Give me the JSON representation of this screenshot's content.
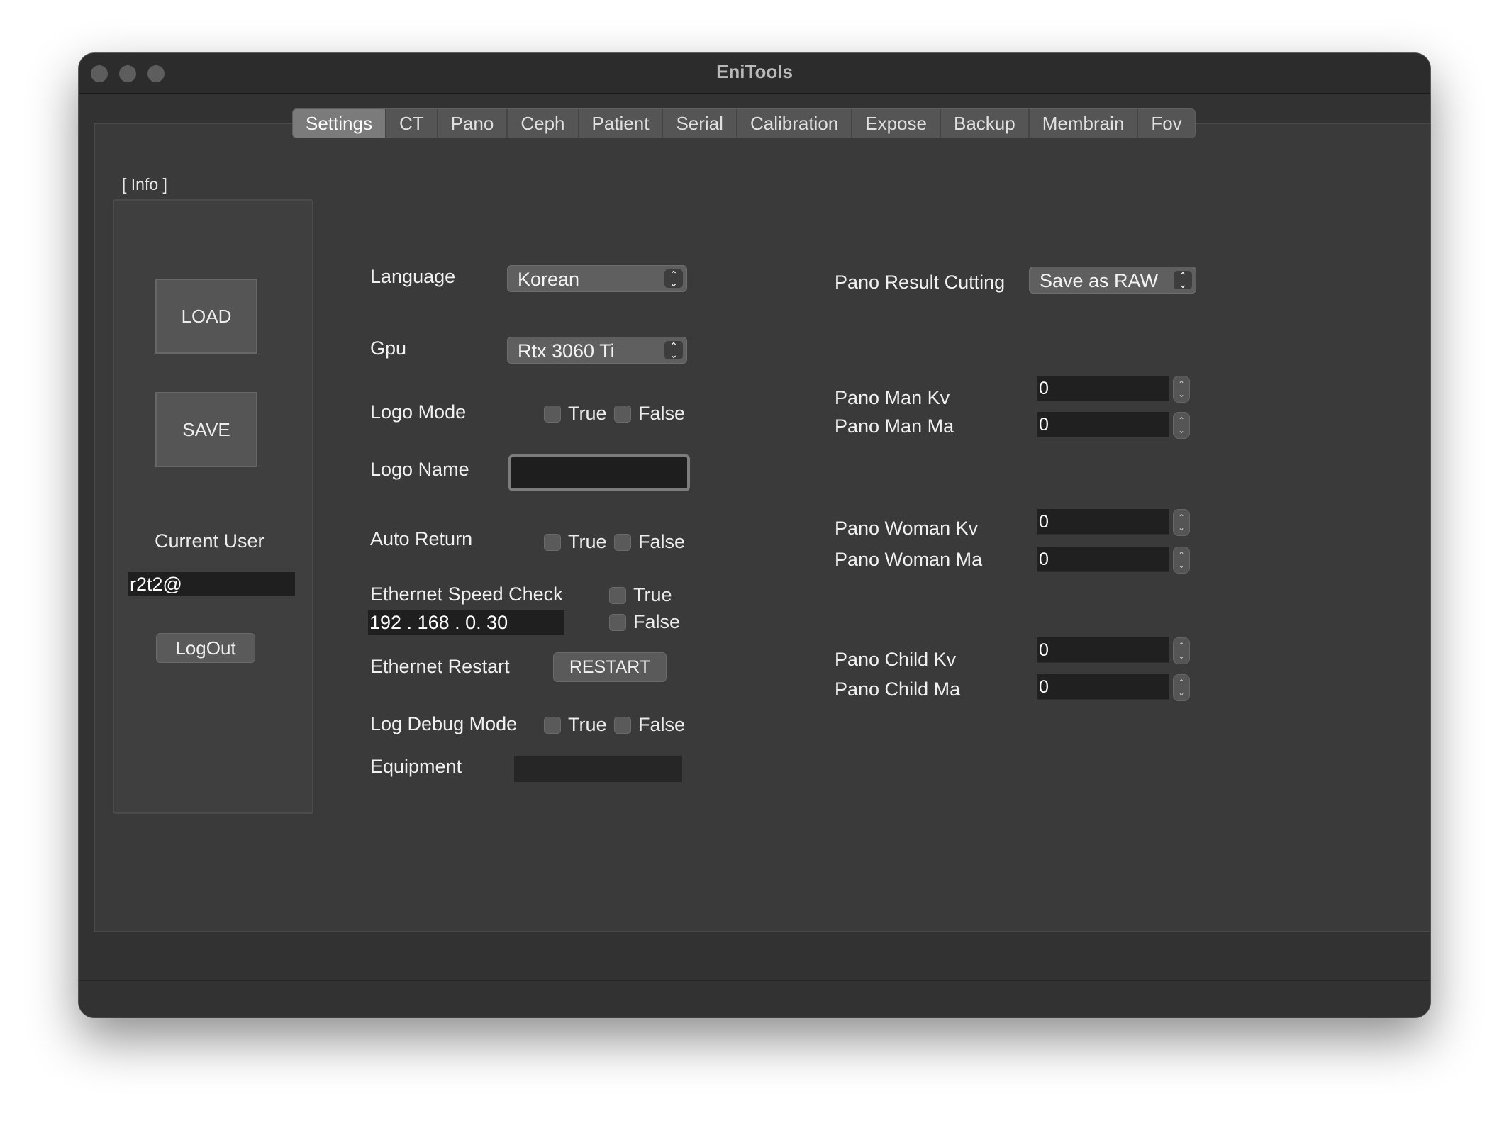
{
  "window": {
    "title": "EniTools"
  },
  "tabs": [
    "Settings",
    "CT",
    "Pano",
    "Ceph",
    "Patient",
    "Serial",
    "Calibration",
    "Expose",
    "Backup",
    "Membrain",
    "Fov"
  ],
  "active_tab": "Settings",
  "info": {
    "group_label": "[ Info ]",
    "load_label": "LOAD",
    "save_label": "SAVE",
    "current_user_label": "Current User",
    "current_user_value": "r2t2@",
    "logout_label": "LogOut"
  },
  "settings": {
    "language": {
      "label": "Language",
      "value": "Korean"
    },
    "gpu": {
      "label": "Gpu",
      "value": "Rtx 3060 Ti"
    },
    "logo_mode": {
      "label": "Logo Mode",
      "true_label": "True",
      "false_label": "False"
    },
    "logo_name": {
      "label": "Logo Name",
      "value": ""
    },
    "auto_return": {
      "label": "Auto Return",
      "true_label": "True",
      "false_label": "False"
    },
    "ethernet_speed_check": {
      "label": "Ethernet Speed Check",
      "ip": "192 . 168 . 0. 30",
      "true_label": "True",
      "false_label": "False"
    },
    "ethernet_restart": {
      "label": "Ethernet Restart",
      "button_label": "RESTART"
    },
    "log_debug_mode": {
      "label": "Log Debug Mode",
      "true_label": "True",
      "false_label": "False"
    },
    "equipment": {
      "label": "Equipment",
      "value": ""
    }
  },
  "pano": {
    "result_cutting": {
      "label": "Pano Result Cutting",
      "value": "Save as RAW"
    },
    "man_kv": {
      "label": "Pano Man Kv",
      "value": "0"
    },
    "man_ma": {
      "label": "Pano Man Ma",
      "value": "0"
    },
    "woman_kv": {
      "label": "Pano Woman Kv",
      "value": "0"
    },
    "woman_ma": {
      "label": "Pano Woman Ma",
      "value": "0"
    },
    "child_kv": {
      "label": "Pano Child Kv",
      "value": "0"
    },
    "child_ma": {
      "label": "Pano Child Ma",
      "value": "0"
    }
  },
  "icons": {
    "popup_arrows": "up-down-chevron-icon",
    "stepper": "stepper-icon"
  }
}
